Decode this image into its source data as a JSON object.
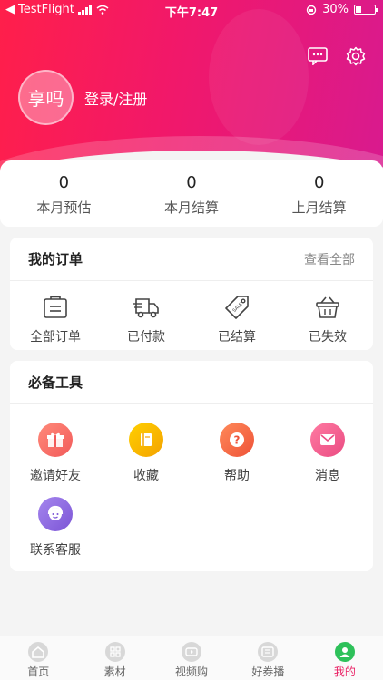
{
  "status_bar": {
    "carrier": "TestFlight",
    "time": "下午7:47",
    "battery": "30%"
  },
  "profile": {
    "avatar_text": "享吗",
    "login_label": "登录/注册"
  },
  "stats": [
    {
      "value": "0",
      "label": "本月预估"
    },
    {
      "value": "0",
      "label": "本月结算"
    },
    {
      "value": "0",
      "label": "上月结算"
    }
  ],
  "orders": {
    "title": "我的订单",
    "view_all": "查看全部",
    "items": [
      {
        "label": "全部订单",
        "icon": "clipboard-icon"
      },
      {
        "label": "已付款",
        "icon": "delivery-truck-icon"
      },
      {
        "label": "已结算",
        "icon": "sale-tag-icon"
      },
      {
        "label": "已失效",
        "icon": "basket-icon"
      }
    ]
  },
  "tools": {
    "title": "必备工具",
    "items": [
      {
        "label": "邀请好友",
        "icon": "gift-icon",
        "color": "#f96a6a"
      },
      {
        "label": "收藏",
        "icon": "book-icon",
        "color": "#f7b200"
      },
      {
        "label": "帮助",
        "icon": "question-icon",
        "color": "#f46a4a"
      },
      {
        "label": "消息",
        "icon": "mail-icon",
        "color": "#f0558c"
      },
      {
        "label": "联系客服",
        "icon": "service-agent-icon",
        "color": "#8a63d8"
      }
    ]
  },
  "tabbar": {
    "items": [
      {
        "label": "首页",
        "icon": "home-icon"
      },
      {
        "label": "素材",
        "icon": "grid-icon"
      },
      {
        "label": "视频购",
        "icon": "video-icon"
      },
      {
        "label": "好券播",
        "icon": "coupon-icon"
      },
      {
        "label": "我的",
        "icon": "user-icon",
        "active": true
      }
    ]
  },
  "colors": {
    "brand": "#e91e63",
    "header_start": "#ff1f4a",
    "header_end": "#d81a8f"
  }
}
